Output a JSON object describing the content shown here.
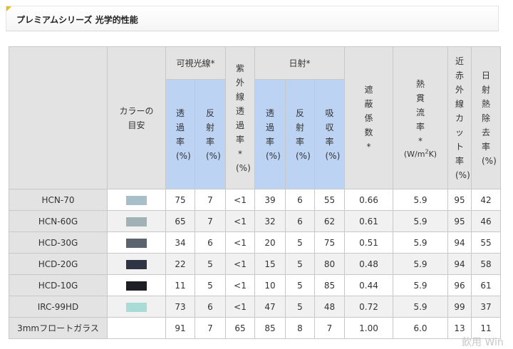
{
  "section_title": "プレミアムシリーズ 光学的性能",
  "headers": {
    "color_guide": "カラーの目安",
    "visible_light": "可視光線*",
    "uv_transmittance": "紫外線透過率*(%)",
    "solar": "日射*",
    "transmittance": "透過率(%)",
    "reflectance": "反射率(%)",
    "absorptance": "吸収率(%)",
    "shading_coefficient": "遮蔽係数*",
    "heat_transfer_pre": "熱貫流率*",
    "heat_transfer_unit_a": "(W/m",
    "heat_transfer_unit_sup": "2",
    "heat_transfer_unit_b": "K)",
    "near_ir_cut": "近赤外線カット率(%)",
    "solar_heat_rejection": "日射熱除去率(%)"
  },
  "rows": [
    {
      "name": "HCN-70",
      "swatch": "#a6bfc9",
      "vt": "75",
      "vr": "7",
      "uv": "<1",
      "st": "39",
      "sr": "6",
      "sa": "55",
      "sc": "0.66",
      "u": "5.9",
      "nir": "95",
      "shr": "42"
    },
    {
      "name": "HCN-60G",
      "swatch": "#a2b1b5",
      "vt": "65",
      "vr": "7",
      "uv": "<1",
      "st": "32",
      "sr": "6",
      "sa": "62",
      "sc": "0.61",
      "u": "5.9",
      "nir": "95",
      "shr": "46"
    },
    {
      "name": "HCD-30G",
      "swatch": "#5b6270",
      "vt": "34",
      "vr": "6",
      "uv": "<1",
      "st": "20",
      "sr": "5",
      "sa": "75",
      "sc": "0.51",
      "u": "5.9",
      "nir": "94",
      "shr": "55"
    },
    {
      "name": "HCD-20G",
      "swatch": "#2e3444",
      "vt": "22",
      "vr": "5",
      "uv": "<1",
      "st": "15",
      "sr": "5",
      "sa": "80",
      "sc": "0.48",
      "u": "5.9",
      "nir": "94",
      "shr": "58"
    },
    {
      "name": "HCD-10G",
      "swatch": "#1c1f24",
      "vt": "11",
      "vr": "5",
      "uv": "<1",
      "st": "10",
      "sr": "5",
      "sa": "85",
      "sc": "0.44",
      "u": "5.9",
      "nir": "96",
      "shr": "61"
    },
    {
      "name": "IRC-99HD",
      "swatch": "#a9dcd6",
      "vt": "73",
      "vr": "6",
      "uv": "<1",
      "st": "47",
      "sr": "5",
      "sa": "48",
      "sc": "0.72",
      "u": "5.9",
      "nir": "99",
      "shr": "37"
    },
    {
      "name": "3mmフロートガラス",
      "swatch": "",
      "vt": "91",
      "vr": "7",
      "uv": "65",
      "st": "85",
      "sr": "8",
      "sa": "7",
      "sc": "1.00",
      "u": "6.0",
      "nir": "13",
      "shr": "11"
    }
  ],
  "watermark": "飲用 Win"
}
